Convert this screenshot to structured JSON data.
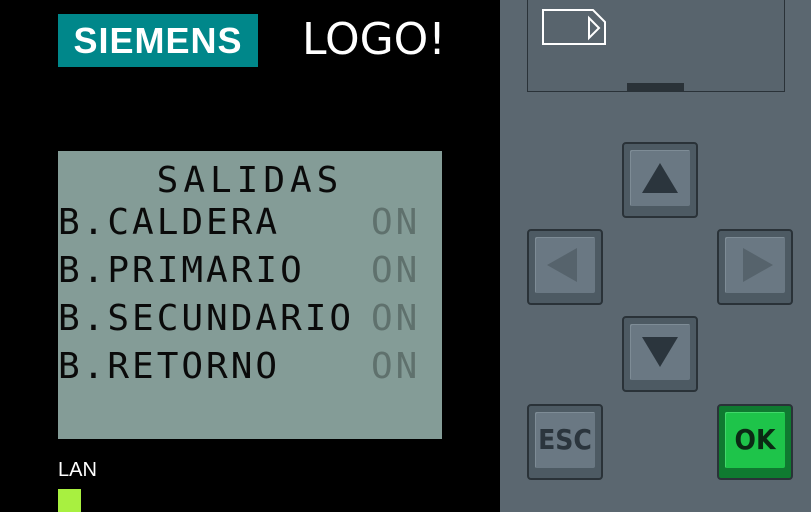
{
  "brand": {
    "logo_text": "SIEMENS",
    "product_name": "LOGO!"
  },
  "display": {
    "title": "SALIDAS",
    "rows": [
      {
        "label": "B.CALDERA",
        "state": "ON"
      },
      {
        "label": "B.PRIMARIO",
        "state": "ON"
      },
      {
        "label": "B.SECUNDARIO",
        "state": "ON"
      },
      {
        "label": "B.RETORNO",
        "state": "ON"
      }
    ]
  },
  "status": {
    "lan_label": "LAN"
  },
  "keypad": {
    "up_icon": "arrow-up-icon",
    "left_icon": "arrow-left-icon",
    "right_icon": "arrow-right-icon",
    "down_icon": "arrow-down-icon",
    "esc_label": "ESC",
    "ok_label": "OK"
  },
  "colors": {
    "brand": "#00878a",
    "lcd_background": "#849c97",
    "lcd_text": "#0a0a0a",
    "lcd_dim_text": "#5f716d",
    "panel": "#5b6770",
    "ok_key": "#1ec44a",
    "lan_led": "#a8f040"
  }
}
